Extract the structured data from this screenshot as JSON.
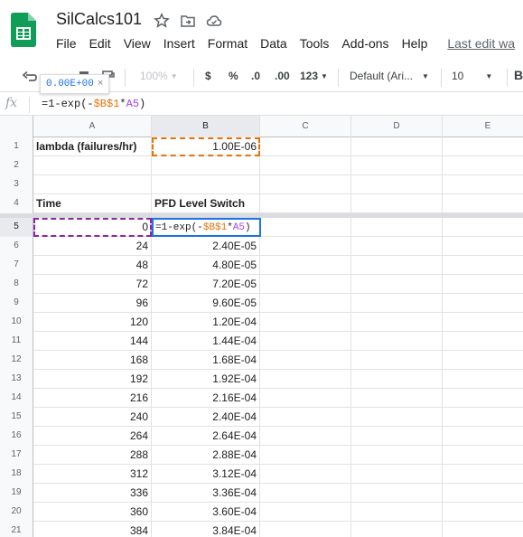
{
  "app": {
    "title": "SilCalcs101",
    "menu": [
      "File",
      "Edit",
      "View",
      "Insert",
      "Format",
      "Data",
      "Tools",
      "Add-ons",
      "Help"
    ],
    "last_edit": "Last edit wa"
  },
  "toolbar": {
    "zoom": "100%",
    "currency": "$",
    "percent": "%",
    "dec_decrease": ".0",
    "dec_increase": ".00",
    "more_formats": "123",
    "font": "Default (Ari...",
    "font_size": "10",
    "tooltip_value": "0.00E+00",
    "tooltip_close": "×"
  },
  "formula_bar": {
    "fx": "fx",
    "formula_prefix": "=1-exp(-",
    "formula_ref1": "$B$1",
    "formula_mid": "*",
    "formula_ref2": "A5",
    "formula_suffix": ")"
  },
  "columns": [
    "A",
    "B",
    "C",
    "D",
    "E"
  ],
  "rows": [
    {
      "n": "1",
      "a": "lambda (failures/hr)",
      "b": "1.00E-06"
    },
    {
      "n": "2",
      "a": "",
      "b": ""
    },
    {
      "n": "3",
      "a": "",
      "b": ""
    },
    {
      "n": "4",
      "a": "Time",
      "b": "PFD Level Switch"
    },
    {
      "n": "5",
      "a": "0",
      "b": ""
    },
    {
      "n": "6",
      "a": "24",
      "b": "2.40E-05"
    },
    {
      "n": "7",
      "a": "48",
      "b": "4.80E-05"
    },
    {
      "n": "8",
      "a": "72",
      "b": "7.20E-05"
    },
    {
      "n": "9",
      "a": "96",
      "b": "9.60E-05"
    },
    {
      "n": "10",
      "a": "120",
      "b": "1.20E-04"
    },
    {
      "n": "11",
      "a": "144",
      "b": "1.44E-04"
    },
    {
      "n": "12",
      "a": "168",
      "b": "1.68E-04"
    },
    {
      "n": "13",
      "a": "192",
      "b": "1.92E-04"
    },
    {
      "n": "14",
      "a": "216",
      "b": "2.16E-04"
    },
    {
      "n": "15",
      "a": "240",
      "b": "2.40E-04"
    },
    {
      "n": "16",
      "a": "264",
      "b": "2.64E-04"
    },
    {
      "n": "17",
      "a": "288",
      "b": "2.88E-04"
    },
    {
      "n": "18",
      "a": "312",
      "b": "3.12E-04"
    },
    {
      "n": "19",
      "a": "336",
      "b": "3.36E-04"
    },
    {
      "n": "20",
      "a": "360",
      "b": "3.60E-04"
    },
    {
      "n": "21",
      "a": "384",
      "b": "3.84E-04"
    }
  ],
  "editor": {
    "prefix": "=1-exp(-",
    "ref1": "$B$1",
    "mid": "*",
    "ref2": "A5",
    "suffix": ")"
  },
  "colors": {
    "accent": "#1a73e8",
    "ref_orange": "#e8710a",
    "ref_purple": "#8e24aa",
    "sheets_green": "#0f9d58"
  },
  "icons": [
    "sheets-logo-icon",
    "star-icon",
    "move-to-folder-icon",
    "cloud-saved-icon",
    "undo-icon",
    "redo-icon",
    "paint-format-icon",
    "chevron-down-icon"
  ]
}
